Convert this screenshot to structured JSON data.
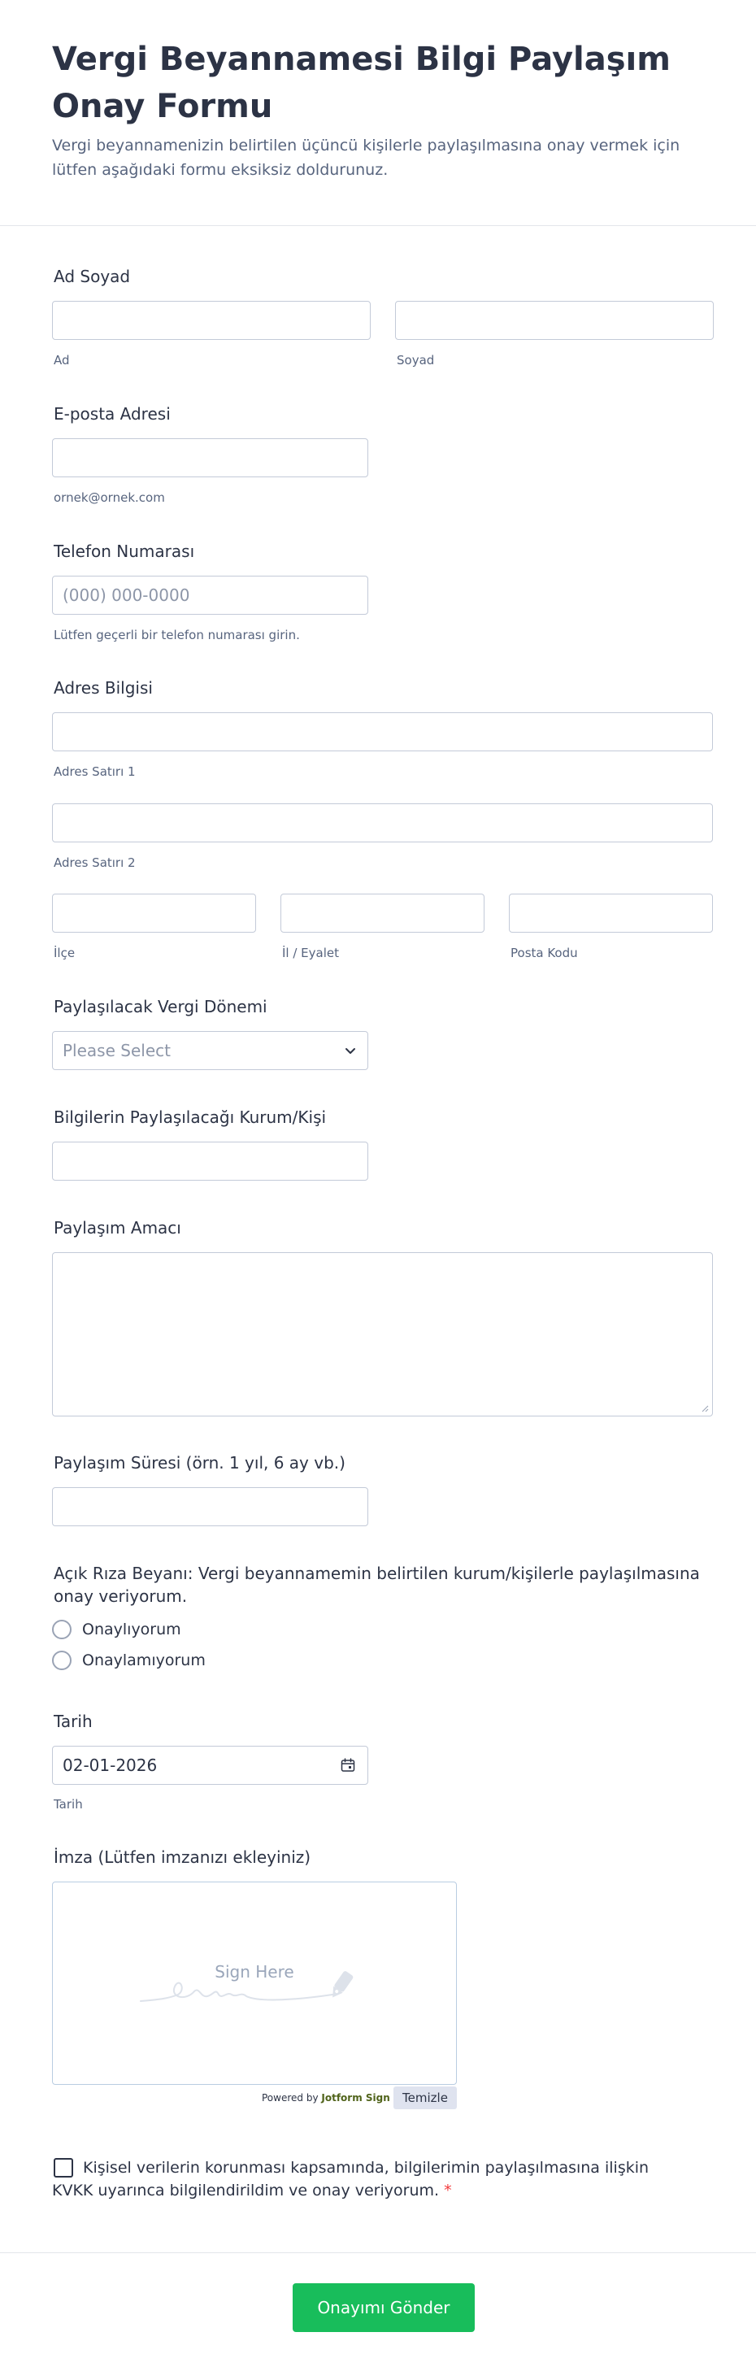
{
  "form": {
    "title": "Vergi Beyannamesi Bilgi Paylaşım Onay Formu",
    "subtitle": "Vergi beyannamenizin belirtilen üçüncü kişilerle paylaşılmasına onay vermek için lütfen aşağıdaki formu eksiksiz doldurunuz."
  },
  "name": {
    "label": "Ad Soyad",
    "first_sublabel": "Ad",
    "last_sublabel": "Soyad",
    "first_value": "",
    "last_value": ""
  },
  "email": {
    "label": "E-posta Adresi",
    "sublabel": "ornek@ornek.com",
    "value": ""
  },
  "phone": {
    "label": "Telefon Numarası",
    "placeholder": "(000) 000-0000",
    "sublabel": "Lütfen geçerli bir telefon numarası girin."
  },
  "address": {
    "label": "Adres Bilgisi",
    "line1_sublabel": "Adres Satırı 1",
    "line2_sublabel": "Adres Satırı 2",
    "district_sublabel": "İlçe",
    "province_sublabel": "İl / Eyalet",
    "postal_sublabel": "Posta Kodu"
  },
  "tax_period": {
    "label": "Paylaşılacak Vergi Dönemi",
    "selected": "Please Select"
  },
  "recipient": {
    "label": "Bilgilerin Paylaşılacağı Kurum/Kişi",
    "value": ""
  },
  "purpose": {
    "label": "Paylaşım Amacı",
    "value": ""
  },
  "duration": {
    "label": "Paylaşım Süresi (örn. 1 yıl, 6 ay vb.)",
    "value": ""
  },
  "consent": {
    "label": "Açık Rıza Beyanı: Vergi beyannamemin belirtilen kurum/kişilerle paylaşılmasına onay veriyorum.",
    "options": [
      "Onaylıyorum",
      "Onaylamıyorum"
    ]
  },
  "date": {
    "label": "Tarih",
    "value": "02-01-2026",
    "sublabel": "Tarih"
  },
  "signature": {
    "label": "İmza (Lütfen imzanızı ekleyiniz)",
    "placeholder": "Sign Here",
    "powered_by": "Powered by",
    "brand_name": "Jotform Sign",
    "clear_label": "Temizle"
  },
  "kvkk": {
    "text": "Kişisel verilerin korunması kapsamında, bilgilerimin paylaşılmasına ilişkin KVKK uyarınca bilgilendirildim ve onay veriyorum.",
    "required_mark": "*"
  },
  "submit": {
    "label": "Onayımı Gönder"
  },
  "colors": {
    "submit_bg": "#18bd5b",
    "required": "#f23a3c",
    "text": "#2c3345",
    "sublabel": "#57647e",
    "border": "#c3cad8"
  }
}
